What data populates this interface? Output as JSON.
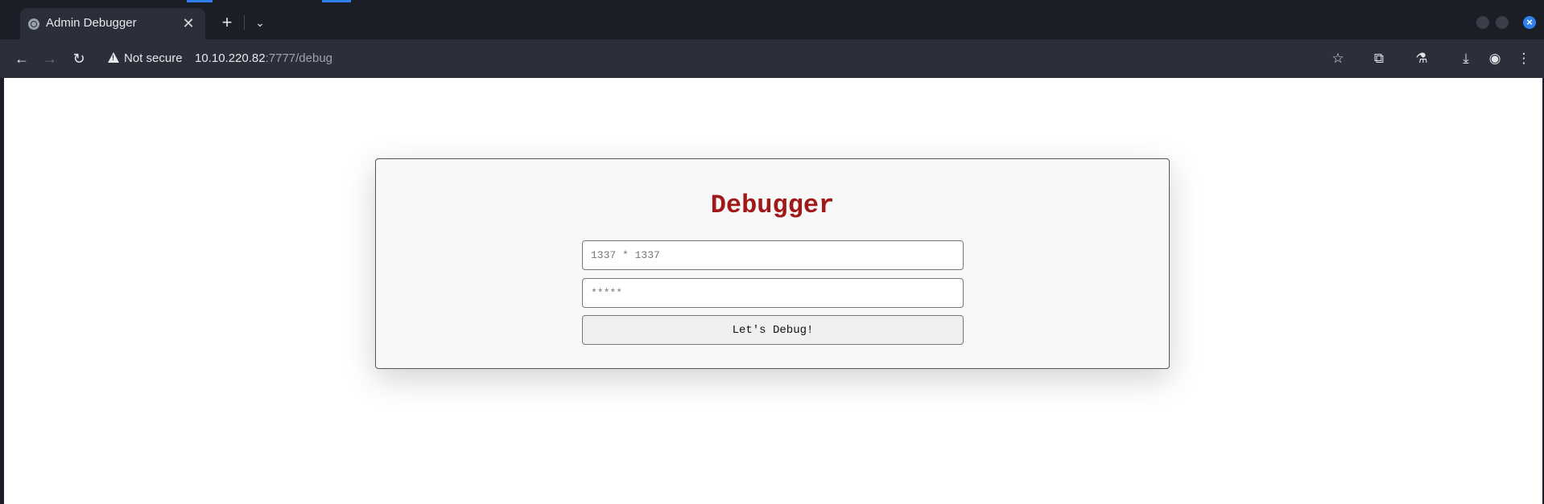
{
  "browser": {
    "tab": {
      "title": "Admin Debugger",
      "favicon": "globe-icon",
      "close_glyph": "✕"
    },
    "new_tab_glyph": "+",
    "tab_list_glyph": "⌄",
    "security_label": "Not secure",
    "url": {
      "host": "10.10.220.82",
      "path": ":7777/debug"
    },
    "icons": [
      "back-icon",
      "forward-icon",
      "reload-icon",
      "warning-icon",
      "star-icon",
      "extensions-icon",
      "labs-icon",
      "download-icon",
      "profile-icon",
      "menu-icon"
    ]
  },
  "page": {
    "heading": "Debugger",
    "expression_input": {
      "value": "",
      "placeholder": "1337 * 1337"
    },
    "password_input": {
      "value": "",
      "placeholder": "*****"
    },
    "submit_label": "Let's Debug!"
  },
  "colors": {
    "heading": "#a01818",
    "browser_frame": "#1b1e26",
    "toolbar": "#2b2f3a",
    "accent": "#2f80ed"
  }
}
